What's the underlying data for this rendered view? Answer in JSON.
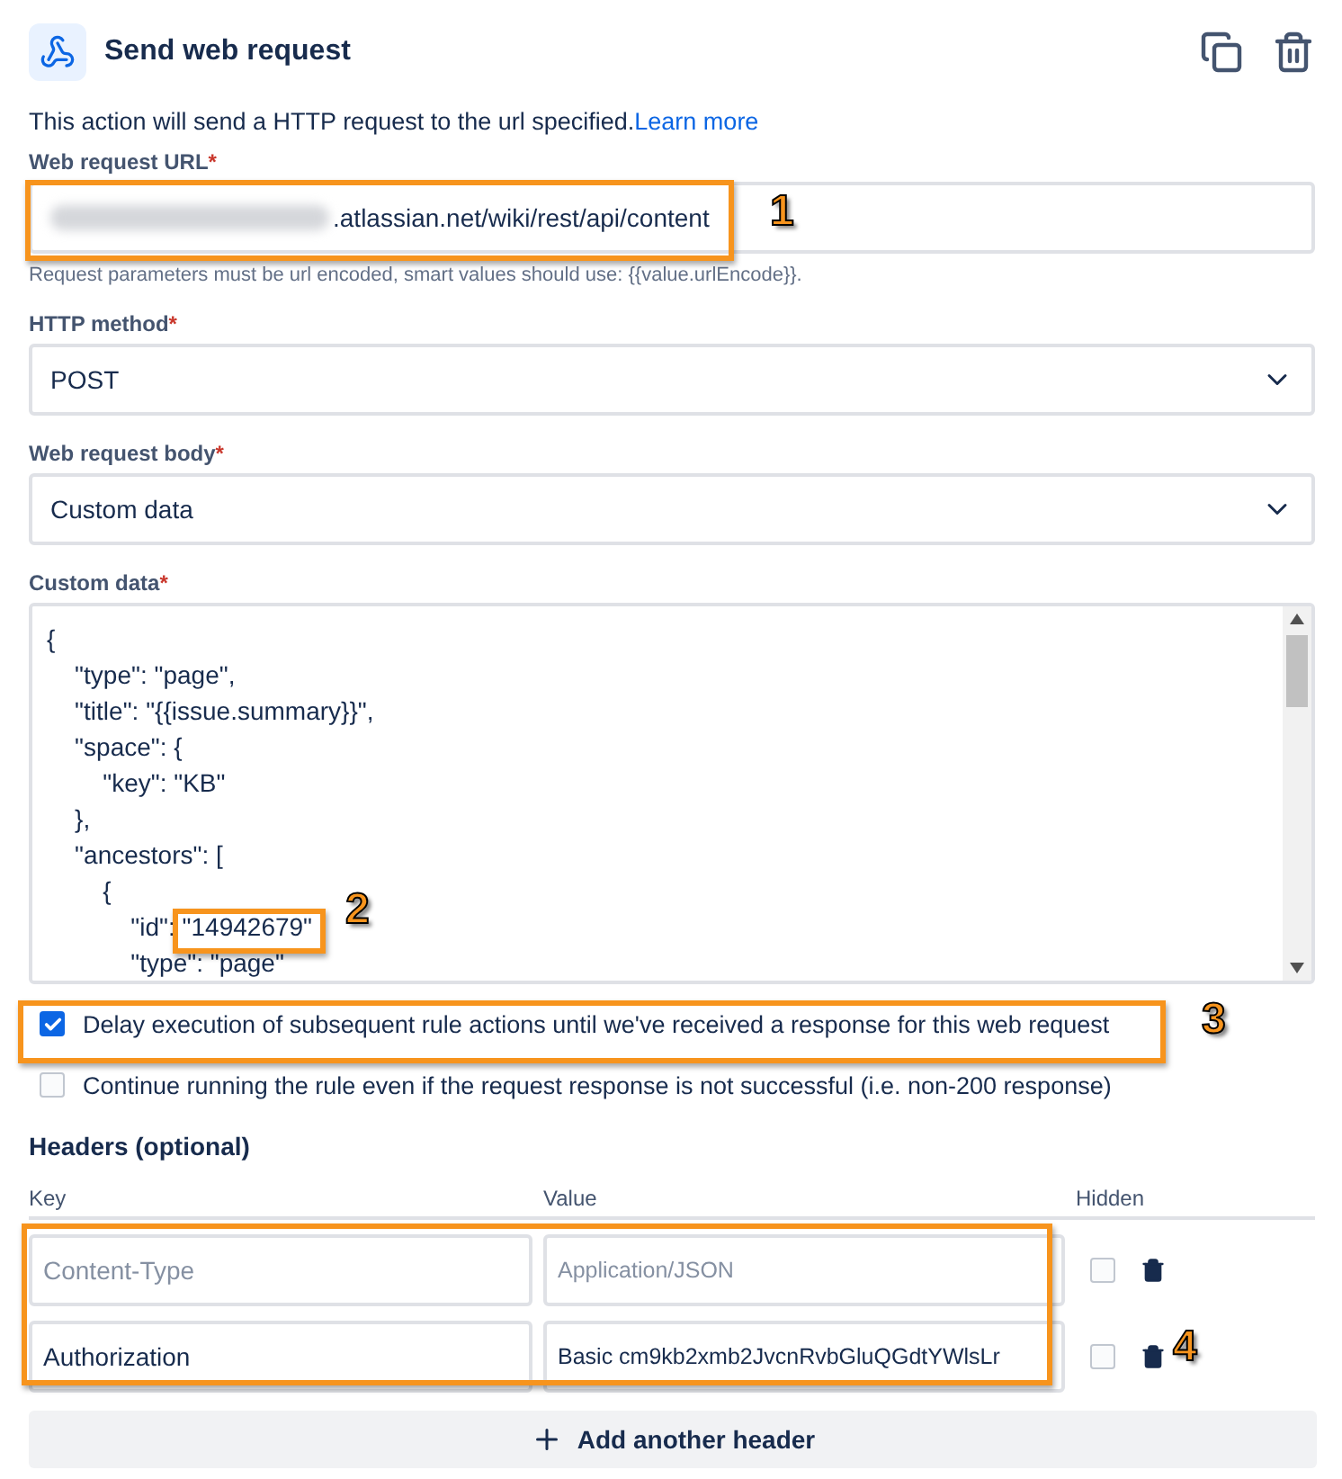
{
  "header": {
    "title": "Send web request"
  },
  "description": {
    "text": "This action will send a HTTP request to the url specified.",
    "link": "Learn more"
  },
  "url_field": {
    "label": "Web request URL",
    "required": "*",
    "redacted": true,
    "value": ".atlassian.net/wiki/rest/api/content",
    "help": "Request parameters must be url encoded, smart values should use: {{value.urlEncode}}."
  },
  "method_field": {
    "label": "HTTP method",
    "required": "*",
    "value": "POST"
  },
  "body_field": {
    "label": "Web request body",
    "required": "*",
    "value": "Custom data"
  },
  "custom_data": {
    "label": "Custom data",
    "required": "*",
    "lines": [
      "{",
      "    \"type\": \"page\",",
      "    \"title\": \"{{issue.summary}}\",",
      "    \"space\": {",
      "        \"key\": \"KB\"",
      "    },",
      "    \"ancestors\": [",
      "        {",
      "            \"id\": \"14942679\"",
      "            \"type\": \"page\""
    ]
  },
  "options": [
    {
      "label": "Delay execution of subsequent rule actions until we've received a response for this web request",
      "checked": true
    },
    {
      "label": "Continue running the rule even if the request response is not successful (i.e. non-200 response)",
      "checked": false
    }
  ],
  "headers": {
    "title": "Headers (optional)",
    "columns": [
      "Key",
      "Value",
      "Hidden"
    ],
    "rows": [
      {
        "key": {
          "placeholder": "Content-Type"
        },
        "value": {
          "placeholder": "Application/JSON"
        },
        "hidden": false
      },
      {
        "key": {
          "value": "Authorization"
        },
        "value": {
          "value": "Basic cm9kb2xmb2JvcnRvbGluQGdtYWlsLr"
        },
        "hidden": false
      }
    ],
    "add_button": "Add another header"
  },
  "callouts": [
    "1",
    "2",
    "3",
    "4"
  ]
}
